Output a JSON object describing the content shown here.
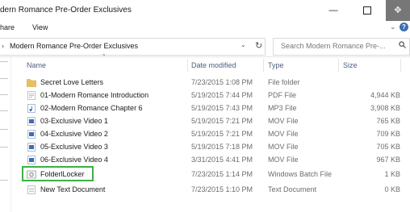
{
  "window": {
    "title": "dern Romance Pre-Order Exclusives",
    "min_glyph": "—",
    "close_glyph": "✥"
  },
  "ribbon": {
    "tabs": [
      "hare",
      "View"
    ]
  },
  "address": {
    "path": "Modern Romance Pre-Order Exclusives"
  },
  "search": {
    "placeholder": "Search Modern Romance Pre-..."
  },
  "columns": {
    "name": "Name",
    "date": "Date modified",
    "type": "Type",
    "size": "Size"
  },
  "files": [
    {
      "icon": "folder-icon",
      "name": "Secret Love Letters",
      "date": "7/23/2015 1:08 PM",
      "type": "File folder",
      "size": ""
    },
    {
      "icon": "pdf-file-icon",
      "name": "01-Modern Romance Introduction",
      "date": "5/19/2015 7:44 PM",
      "type": "PDF File",
      "size": "4,944 KB"
    },
    {
      "icon": "audio-file-icon",
      "name": "02-Modern Romance Chapter 6",
      "date": "5/19/2015 7:43 PM",
      "type": "MP3 File",
      "size": "3,908 KB"
    },
    {
      "icon": "video-file-icon",
      "name": "03-Exclusive Video 1",
      "date": "5/19/2015 7:21 PM",
      "type": "MOV File",
      "size": "765 KB"
    },
    {
      "icon": "video-file-icon",
      "name": "04-Exclusive Video 2",
      "date": "5/19/2015 7:21 PM",
      "type": "MOV File",
      "size": "709 KB"
    },
    {
      "icon": "video-file-icon",
      "name": "05-Exclusive Video 3",
      "date": "5/19/2015 7:18 PM",
      "type": "MOV File",
      "size": "705 KB"
    },
    {
      "icon": "video-file-icon",
      "name": "06-Exclusive Video 4",
      "date": "3/31/2015 4:41 PM",
      "type": "MOV File",
      "size": "967 KB"
    },
    {
      "icon": "batch-file-icon",
      "name": "FolderlLocker",
      "date": "7/23/2015 1:14 PM",
      "type": "Windows Batch File",
      "size": "1 KB"
    },
    {
      "icon": "text-file-icon",
      "name": "New Text Document",
      "date": "7/23/2015 1:10 PM",
      "type": "Text Document",
      "size": "0 KB"
    }
  ],
  "colors": {
    "highlight": "#3db143",
    "folder": "#e8c15a",
    "accent": "#3c6eb4"
  }
}
